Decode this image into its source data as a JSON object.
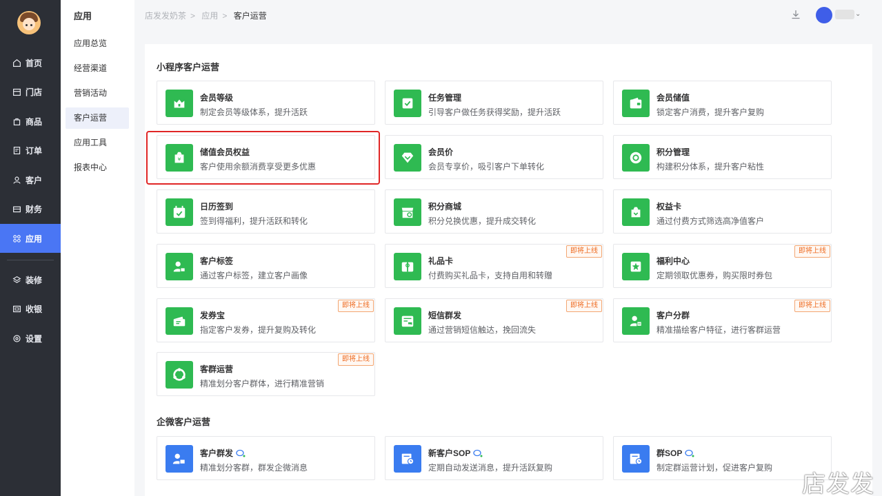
{
  "nav": {
    "items": [
      {
        "label": "首页",
        "icon": "home-icon"
      },
      {
        "label": "门店",
        "icon": "store-icon"
      },
      {
        "label": "商品",
        "icon": "bag-icon"
      },
      {
        "label": "订单",
        "icon": "order-icon"
      },
      {
        "label": "客户",
        "icon": "user-icon"
      },
      {
        "label": "财务",
        "icon": "wallet-icon"
      },
      {
        "label": "应用",
        "icon": "apps-icon"
      },
      {
        "label": "装修",
        "icon": "layers-icon"
      },
      {
        "label": "收银",
        "icon": "cashier-icon"
      },
      {
        "label": "设置",
        "icon": "gear-icon"
      }
    ],
    "active": "应用"
  },
  "subnav": {
    "title": "应用",
    "items": [
      "应用总览",
      "经营渠道",
      "营销活动",
      "客户运营",
      "应用工具",
      "报表中心"
    ],
    "active": "客户运营"
  },
  "breadcrumb": [
    "店发发奶茶",
    "应用",
    "客户运营"
  ],
  "sections": {
    "mini": {
      "title": "小程序客户运营",
      "cards": [
        {
          "title": "会员等级",
          "desc": "制定会员等级体系，提升活跃",
          "badge": ""
        },
        {
          "title": "任务管理",
          "desc": "引导客户做任务获得奖励，提升活跃",
          "badge": ""
        },
        {
          "title": "会员储值",
          "desc": "锁定客户消费，提升客户复购",
          "badge": ""
        },
        {
          "title": "储值会员权益",
          "desc": "客户使用余额消费享受更多优惠",
          "badge": ""
        },
        {
          "title": "会员价",
          "desc": "会员专享价，吸引客户下单转化",
          "badge": ""
        },
        {
          "title": "积分管理",
          "desc": "构建积分体系，提升客户粘性",
          "badge": ""
        },
        {
          "title": "日历签到",
          "desc": "签到得福利，提升活跃和转化",
          "badge": ""
        },
        {
          "title": "积分商城",
          "desc": "积分兑换优惠，提升成交转化",
          "badge": ""
        },
        {
          "title": "权益卡",
          "desc": "通过付费方式筛选高净值客户",
          "badge": ""
        },
        {
          "title": "客户标签",
          "desc": "通过客户标签，建立客户画像",
          "badge": ""
        },
        {
          "title": "礼品卡",
          "desc": "付费购买礼品卡，支持自用和转赠",
          "badge": "即将上线"
        },
        {
          "title": "福利中心",
          "desc": "定期领取优惠券，购买限时券包",
          "badge": "即将上线"
        },
        {
          "title": "发券宝",
          "desc": "指定客户发券，提升复购及转化",
          "badge": "即将上线"
        },
        {
          "title": "短信群发",
          "desc": "通过营销短信触达，挽回流失",
          "badge": "即将上线"
        },
        {
          "title": "客户分群",
          "desc": "精准描绘客户特征，进行客群运营",
          "badge": "即将上线"
        },
        {
          "title": "客群运营",
          "desc": "精准划分客户群体，进行精准营销",
          "badge": "即将上线"
        }
      ]
    },
    "wecom": {
      "title": "企微客户运营",
      "cards": [
        {
          "title": "客户群发",
          "desc": "精准划分客群，群发企微消息"
        },
        {
          "title": "新客户SOP",
          "desc": "定期自动发送消息，提升活跃复购"
        },
        {
          "title": "群SOP",
          "desc": "制定群运营计划，促进客户复购"
        }
      ]
    }
  },
  "colors": {
    "green": "#2fba52",
    "blue": "#3a7cf0",
    "accent": "#4a76f4",
    "badge": "#ee6a1f",
    "highlight": "#e02525"
  },
  "watermark": "店发发"
}
